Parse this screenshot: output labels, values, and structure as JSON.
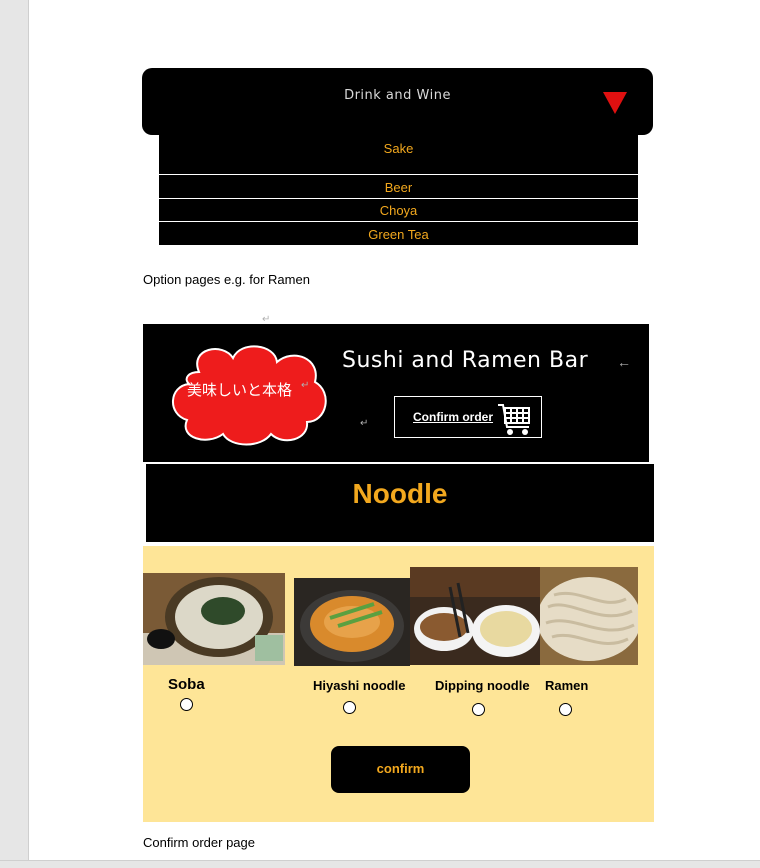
{
  "dropdown": {
    "title": "Drink and Wine",
    "items": [
      "Sake",
      "Beer",
      "Choya",
      "Green Tea"
    ],
    "accent": "#f2a81e",
    "arrow_color": "#e01010"
  },
  "captions": {
    "options": "Option pages e.g. for Ramen",
    "confirm": "Confirm order page"
  },
  "header": {
    "cloud_text": "美味しいと本格",
    "brand": "Sushi and Ramen Bar",
    "confirm_order": "Confirm order",
    "cart_icon": "shopping-cart-icon"
  },
  "noodle": {
    "title": "Noodle",
    "options": [
      {
        "label": "Soba",
        "photo": "soba-photo"
      },
      {
        "label": "Hiyashi noodle",
        "photo": "hiyashi-noodle-photo"
      },
      {
        "label": "Dipping noodle",
        "photo": "dipping-noodle-photo"
      },
      {
        "label": "Ramen",
        "photo": "ramen-photo"
      }
    ],
    "confirm_label": "confirm",
    "panel_color": "#fee597"
  }
}
